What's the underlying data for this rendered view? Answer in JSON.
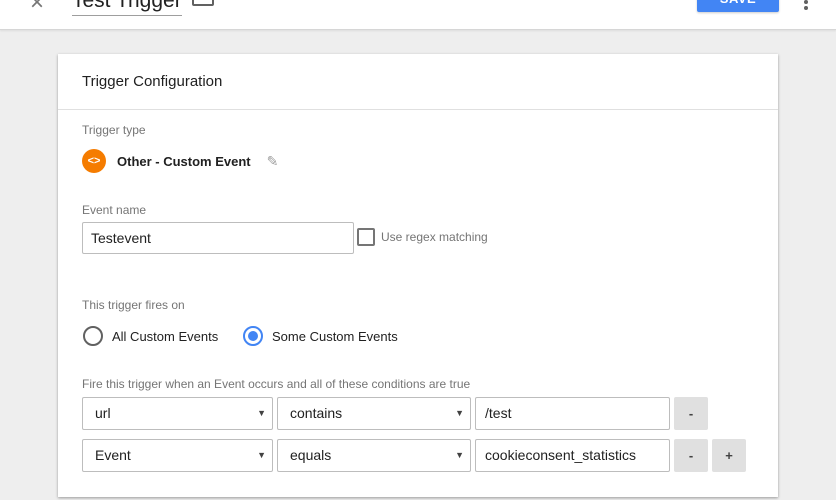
{
  "topbar": {
    "close_icon": "×",
    "title": "Test Trigger",
    "save_label": "SAVE"
  },
  "card": {
    "title": "Trigger Configuration",
    "trigger_type_label": "Trigger type",
    "trigger_type_icon": "<>",
    "trigger_type_name": "Other - Custom Event",
    "edit_icon": "✎",
    "event_name_label": "Event name",
    "event_name_value": "Testevent",
    "regex_label": "Use regex matching",
    "fires_on_label": "This trigger fires on",
    "radio_all": "All Custom Events",
    "radio_some": "Some Custom Events",
    "conditions_label": "Fire this trigger when an Event occurs and all of these conditions are true",
    "conditions": [
      {
        "variable": "url",
        "operator": "contains",
        "value": "/test",
        "remove": "-"
      },
      {
        "variable": "Event",
        "operator": "equals",
        "value": "cookieconsent_statistics",
        "remove": "-",
        "add": "+"
      }
    ]
  }
}
